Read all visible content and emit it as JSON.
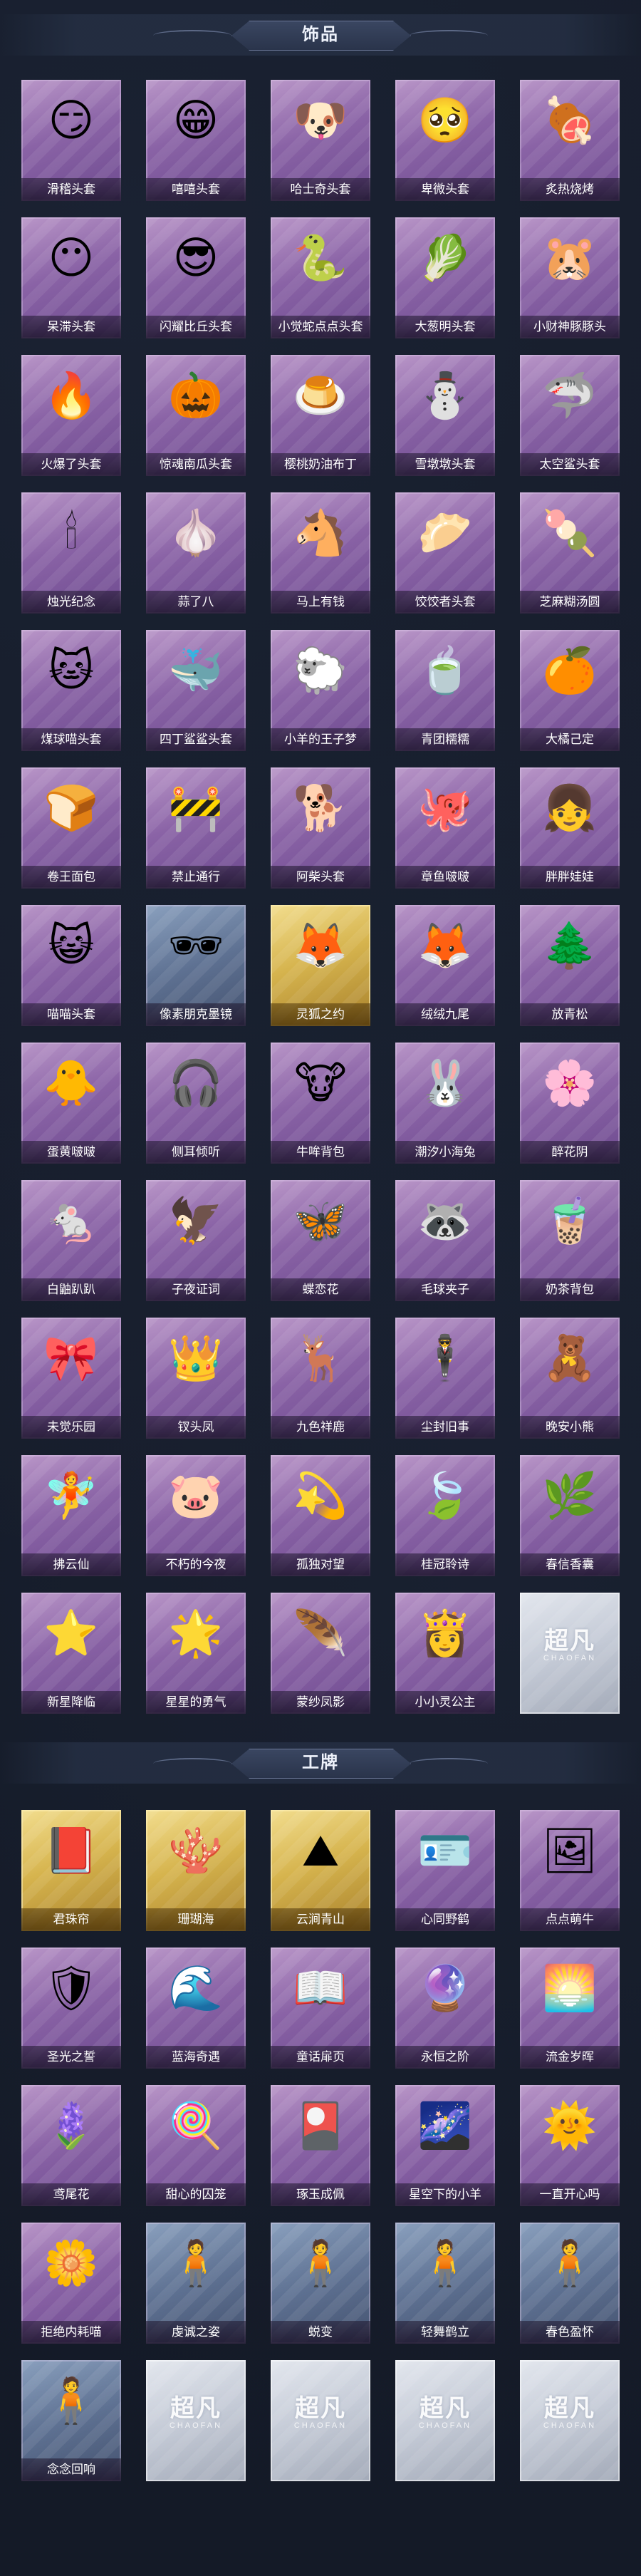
{
  "sections": [
    {
      "title": "饰品",
      "items": [
        {
          "label": "滑稽头套",
          "icon": "😏",
          "tier": "purple"
        },
        {
          "label": "嘻嘻头套",
          "icon": "😁",
          "tier": "purple"
        },
        {
          "label": "哈士奇头套",
          "icon": "🐶",
          "tier": "purple"
        },
        {
          "label": "卑微头套",
          "icon": "🥺",
          "tier": "purple"
        },
        {
          "label": "炙热烧烤",
          "icon": "🍖",
          "tier": "purple"
        },
        {
          "label": "呆滞头套",
          "icon": "😶",
          "tier": "purple"
        },
        {
          "label": "闪耀比丘头套",
          "icon": "😎",
          "tier": "purple"
        },
        {
          "label": "小觉蛇点点头套",
          "icon": "🐍",
          "tier": "purple"
        },
        {
          "label": "大葱明头套",
          "icon": "🥬",
          "tier": "purple"
        },
        {
          "label": "小财神豚豚头",
          "icon": "🐹",
          "tier": "purple"
        },
        {
          "label": "火爆了头套",
          "icon": "🔥",
          "tier": "purple"
        },
        {
          "label": "惊魂南瓜头套",
          "icon": "🎃",
          "tier": "purple"
        },
        {
          "label": "樱桃奶油布丁",
          "icon": "🍮",
          "tier": "purple"
        },
        {
          "label": "雪墩墩头套",
          "icon": "⛄",
          "tier": "purple"
        },
        {
          "label": "太空鲨头套",
          "icon": "🦈",
          "tier": "purple"
        },
        {
          "label": "烛光纪念",
          "icon": "🕯",
          "tier": "purple"
        },
        {
          "label": "蒜了八",
          "icon": "🧄",
          "tier": "purple"
        },
        {
          "label": "马上有钱",
          "icon": "🐴",
          "tier": "purple"
        },
        {
          "label": "饺饺者头套",
          "icon": "🥟",
          "tier": "purple"
        },
        {
          "label": "芝麻糊汤圆",
          "icon": "🍡",
          "tier": "purple"
        },
        {
          "label": "煤球喵头套",
          "icon": "🐱",
          "tier": "purple"
        },
        {
          "label": "四丁鲨鲨头套",
          "icon": "🐳",
          "tier": "purple"
        },
        {
          "label": "小羊的王子梦",
          "icon": "🐑",
          "tier": "purple"
        },
        {
          "label": "青团糯糯",
          "icon": "🍵",
          "tier": "purple"
        },
        {
          "label": "大橘己定",
          "icon": "🍊",
          "tier": "purple"
        },
        {
          "label": "卷王面包",
          "icon": "🍞",
          "tier": "purple"
        },
        {
          "label": "禁止通行",
          "icon": "🚧",
          "tier": "purple"
        },
        {
          "label": "阿柴头套",
          "icon": "🐕",
          "tier": "purple"
        },
        {
          "label": "章鱼啵啵",
          "icon": "🐙",
          "tier": "purple"
        },
        {
          "label": "胖胖娃娃",
          "icon": "👧",
          "tier": "purple"
        },
        {
          "label": "喵喵头套",
          "icon": "😺",
          "tier": "purple"
        },
        {
          "label": "像素朋克墨镜",
          "icon": "🕶",
          "tier": "blue"
        },
        {
          "label": "灵狐之约",
          "icon": "🦊",
          "tier": "gold"
        },
        {
          "label": "绒绒九尾",
          "icon": "🦊",
          "tier": "purple"
        },
        {
          "label": "放青松",
          "icon": "🌲",
          "tier": "purple"
        },
        {
          "label": "蛋黄啵啵",
          "icon": "🐥",
          "tier": "purple"
        },
        {
          "label": "侧耳倾听",
          "icon": "🎧",
          "tier": "purple"
        },
        {
          "label": "牛哞背包",
          "icon": "🐮",
          "tier": "purple"
        },
        {
          "label": "潮汐小海兔",
          "icon": "🐰",
          "tier": "purple"
        },
        {
          "label": "醉花阴",
          "icon": "🌸",
          "tier": "purple"
        },
        {
          "label": "白鼬趴趴",
          "icon": "🐁",
          "tier": "purple"
        },
        {
          "label": "子夜证词",
          "icon": "🦅",
          "tier": "purple"
        },
        {
          "label": "蝶恋花",
          "icon": "🦋",
          "tier": "purple"
        },
        {
          "label": "毛球夹子",
          "icon": "🦝",
          "tier": "purple"
        },
        {
          "label": "奶茶背包",
          "icon": "🧋",
          "tier": "purple"
        },
        {
          "label": "未觉乐园",
          "icon": "🎀",
          "tier": "purple"
        },
        {
          "label": "钗头凤",
          "icon": "👑",
          "tier": "purple"
        },
        {
          "label": "九色祥鹿",
          "icon": "🦌",
          "tier": "purple"
        },
        {
          "label": "尘封旧事",
          "icon": "🕴",
          "tier": "purple"
        },
        {
          "label": "晚安小熊",
          "icon": "🧸",
          "tier": "purple"
        },
        {
          "label": "拂云仙",
          "icon": "🧚",
          "tier": "purple"
        },
        {
          "label": "不朽的今夜",
          "icon": "🐷",
          "tier": "purple"
        },
        {
          "label": "孤独对望",
          "icon": "💫",
          "tier": "purple"
        },
        {
          "label": "桂冠聆诗",
          "icon": "🍃",
          "tier": "purple"
        },
        {
          "label": "春信香囊",
          "icon": "🌿",
          "tier": "purple"
        },
        {
          "label": "新星降临",
          "icon": "⭐",
          "tier": "purple"
        },
        {
          "label": "星星的勇气",
          "icon": "🌟",
          "tier": "purple"
        },
        {
          "label": "蒙纱凤影",
          "icon": "🪶",
          "tier": "purple"
        },
        {
          "label": "小小灵公主",
          "icon": "👸",
          "tier": "purple"
        },
        {
          "label": "",
          "icon": "",
          "tier": "silver",
          "placeholder": "超凡",
          "placeholder_sub": "CHAOFAN"
        }
      ]
    },
    {
      "title": "工牌",
      "items": [
        {
          "label": "君珠帘",
          "icon": "📕",
          "tier": "gold"
        },
        {
          "label": "珊瑚海",
          "icon": "🪸",
          "tier": "gold"
        },
        {
          "label": "云涧青山",
          "icon": "⛰",
          "tier": "gold"
        },
        {
          "label": "心同野鹤",
          "icon": "🪪",
          "tier": "purple"
        },
        {
          "label": "点点萌牛",
          "icon": "🖼",
          "tier": "purple"
        },
        {
          "label": "圣光之誓",
          "icon": "🛡",
          "tier": "purple"
        },
        {
          "label": "蓝海奇遇",
          "icon": "🌊",
          "tier": "purple"
        },
        {
          "label": "童话扉页",
          "icon": "📖",
          "tier": "purple"
        },
        {
          "label": "永恒之阶",
          "icon": "🔮",
          "tier": "purple"
        },
        {
          "label": "流金岁晖",
          "icon": "🌅",
          "tier": "purple"
        },
        {
          "label": "鸢尾花",
          "icon": "🪻",
          "tier": "purple"
        },
        {
          "label": "甜心的囚笼",
          "icon": "🍭",
          "tier": "purple"
        },
        {
          "label": "琢玉成佩",
          "icon": "🎴",
          "tier": "purple"
        },
        {
          "label": "星空下的小羊",
          "icon": "🌌",
          "tier": "purple"
        },
        {
          "label": "一直开心吗",
          "icon": "🌞",
          "tier": "purple"
        },
        {
          "label": "拒绝内耗喵",
          "icon": "🌼",
          "tier": "purple"
        },
        {
          "label": "虔诚之姿",
          "icon": "🧍",
          "tier": "blue"
        },
        {
          "label": "蜕变",
          "icon": "🧍",
          "tier": "blue"
        },
        {
          "label": "轻舞鹤立",
          "icon": "🧍",
          "tier": "blue"
        },
        {
          "label": "春色盈怀",
          "icon": "🧍",
          "tier": "blue"
        },
        {
          "label": "念念回响",
          "icon": "🧍",
          "tier": "blue"
        },
        {
          "label": "",
          "icon": "",
          "tier": "silver",
          "placeholder": "超凡",
          "placeholder_sub": "CHAOFAN"
        },
        {
          "label": "",
          "icon": "",
          "tier": "silver",
          "placeholder": "超凡",
          "placeholder_sub": "CHAOFAN"
        },
        {
          "label": "",
          "icon": "",
          "tier": "silver",
          "placeholder": "超凡",
          "placeholder_sub": "CHAOFAN"
        },
        {
          "label": "",
          "icon": "",
          "tier": "silver",
          "placeholder": "超凡",
          "placeholder_sub": "CHAOFAN"
        }
      ]
    }
  ],
  "colors": {
    "background": "#141a27",
    "purple_card": "#8a63a6",
    "gold_card": "#d6b44e",
    "silver_card": "#c4cad6",
    "blue_card": "#5e7192"
  }
}
